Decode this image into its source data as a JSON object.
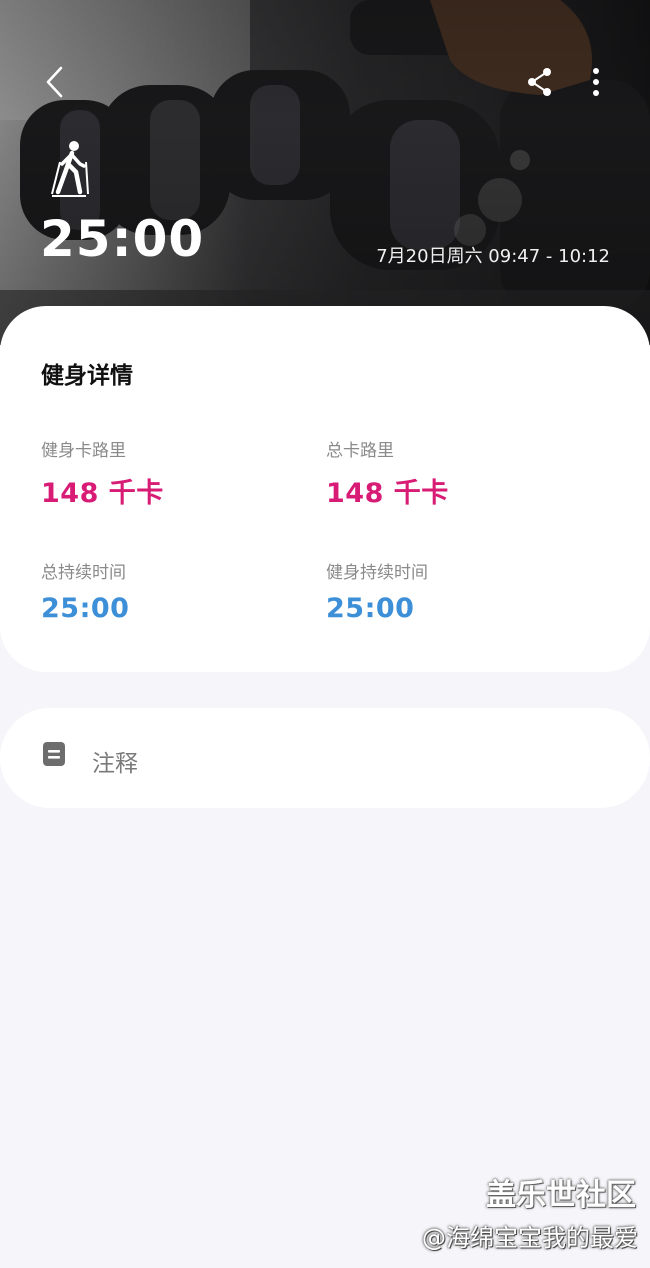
{
  "header": {
    "duration": "25:00",
    "time_range": "7月20日周六 09:47 - 10:12",
    "activity_icon": "hiking-person-icon",
    "back_icon": "chevron-left-icon",
    "share_icon": "share-icon",
    "more_icon": "more-vertical-icon"
  },
  "details": {
    "title": "健身详情",
    "metrics": [
      {
        "label": "健身卡路里",
        "value": "148 千卡",
        "color": "#d81b74"
      },
      {
        "label": "总卡路里",
        "value": "148 千卡",
        "color": "#d81b74"
      },
      {
        "label": "总持续时间",
        "value": "25:00",
        "color": "#3d8fd8"
      },
      {
        "label": "健身持续时间",
        "value": "25:00",
        "color": "#3d8fd8"
      }
    ]
  },
  "notes": {
    "label": "注释",
    "icon": "note-icon"
  },
  "watermark": {
    "line1": "盖乐世社区",
    "line2": "@海绵宝宝我的最爱"
  }
}
